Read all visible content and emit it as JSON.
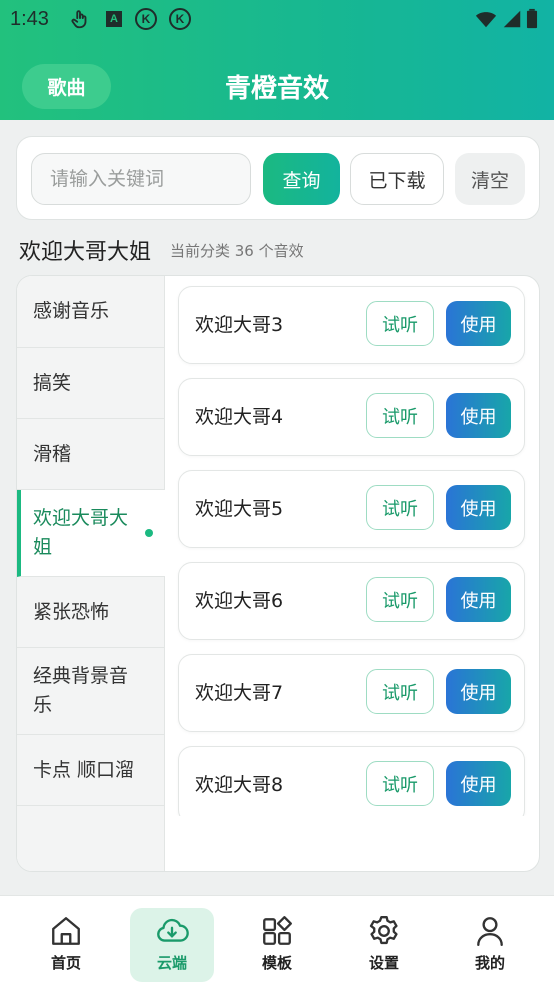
{
  "status_bar": {
    "time": "1:43",
    "icons": [
      "touch-icon",
      "a-icon",
      "k-icon",
      "k-icon",
      "wifi-icon",
      "signal-icon",
      "battery-icon"
    ]
  },
  "header": {
    "songs_button": "歌曲",
    "title": "青橙音效",
    "gradient_colors": [
      "#22c17d",
      "#12b3a4"
    ]
  },
  "search": {
    "placeholder": "请输入关键词",
    "query_button": "查询",
    "downloaded_button": "已下载",
    "clear_button": "清空"
  },
  "category": {
    "title": "欢迎大哥大姐",
    "count_text": "当前分类 36 个音效"
  },
  "sidebar": {
    "items": [
      {
        "label": "感谢音乐",
        "active": false
      },
      {
        "label": "搞笑",
        "active": false
      },
      {
        "label": "滑稽",
        "active": false
      },
      {
        "label": "欢迎大哥大姐",
        "active": true
      },
      {
        "label": "紧张恐怖",
        "active": false
      },
      {
        "label": "经典背景音乐",
        "active": false
      },
      {
        "label": "卡点 顺口溜",
        "active": false
      }
    ]
  },
  "sounds": {
    "listen_label": "试听",
    "use_label": "使用",
    "items": [
      {
        "name": "欢迎大哥3"
      },
      {
        "name": "欢迎大哥4"
      },
      {
        "name": "欢迎大哥5"
      },
      {
        "name": "欢迎大哥6"
      },
      {
        "name": "欢迎大哥7"
      },
      {
        "name": "欢迎大哥8"
      }
    ]
  },
  "bottom_nav": {
    "items": [
      {
        "label": "首页",
        "icon": "home-icon",
        "active": false
      },
      {
        "label": "云端",
        "icon": "cloud-download-icon",
        "active": true
      },
      {
        "label": "模板",
        "icon": "grid-icon",
        "active": false
      },
      {
        "label": "设置",
        "icon": "gear-icon",
        "active": false
      },
      {
        "label": "我的",
        "icon": "user-icon",
        "active": false
      }
    ]
  },
  "colors": {
    "accent_green": "#1bb981",
    "use_button_gradient": [
      "#2a74d6",
      "#18a6a9"
    ]
  }
}
